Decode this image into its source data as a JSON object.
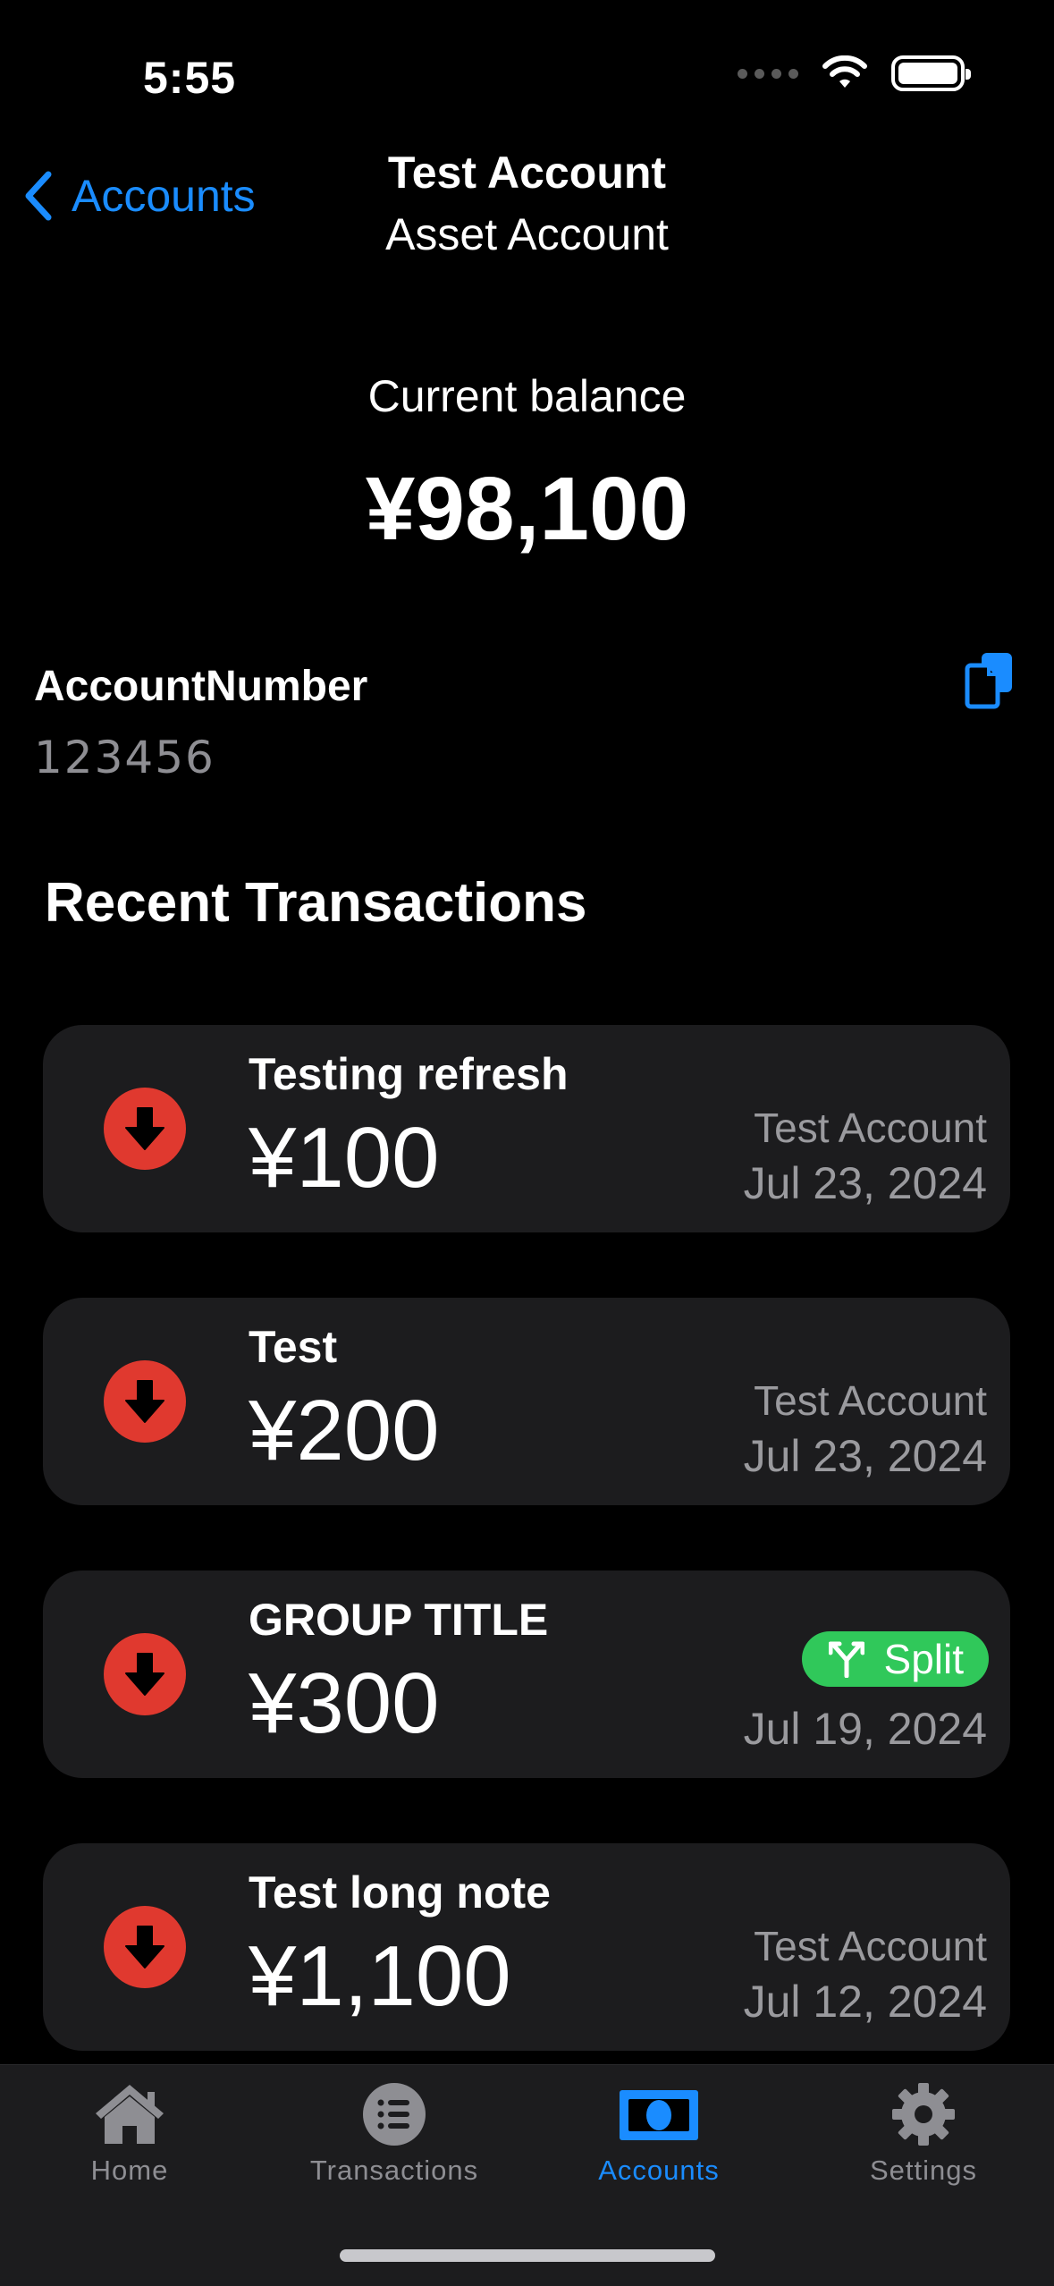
{
  "status_bar": {
    "time": "5:55"
  },
  "nav": {
    "back_label": "Accounts",
    "title": "Test Account",
    "subtitle": "Asset Account"
  },
  "balance": {
    "label": "Current balance",
    "amount": "¥98,100"
  },
  "account_number": {
    "label": "AccountNumber",
    "value": "123456"
  },
  "recent": {
    "title": "Recent Transactions",
    "items": [
      {
        "title": "Testing refresh",
        "amount": "¥100",
        "account": "Test Account",
        "date": "Jul 23, 2024",
        "type": "withdrawal"
      },
      {
        "title": "Test",
        "amount": "¥200",
        "account": "Test Account",
        "date": "Jul 23, 2024",
        "type": "withdrawal"
      },
      {
        "title": "GROUP TITLE",
        "amount": "¥300",
        "badge": "Split",
        "date": "Jul 19, 2024",
        "type": "withdrawal"
      },
      {
        "title": "Test long note",
        "amount": "¥1,100",
        "account": "Test Account",
        "date": "Jul 12, 2024",
        "type": "withdrawal"
      }
    ]
  },
  "tab_bar": {
    "tabs": [
      {
        "label": "Home",
        "icon": "house-icon"
      },
      {
        "label": "Transactions",
        "icon": "list-icon"
      },
      {
        "label": "Accounts",
        "icon": "banknote-icon",
        "active": true
      },
      {
        "label": "Settings",
        "icon": "gear-icon"
      }
    ]
  },
  "colors": {
    "accent": "#1a8cff",
    "withdrawal": "#e0392f",
    "split_badge": "#30c85a",
    "card_bg": "#1c1c1e",
    "secondary_text": "#8e8e93"
  }
}
